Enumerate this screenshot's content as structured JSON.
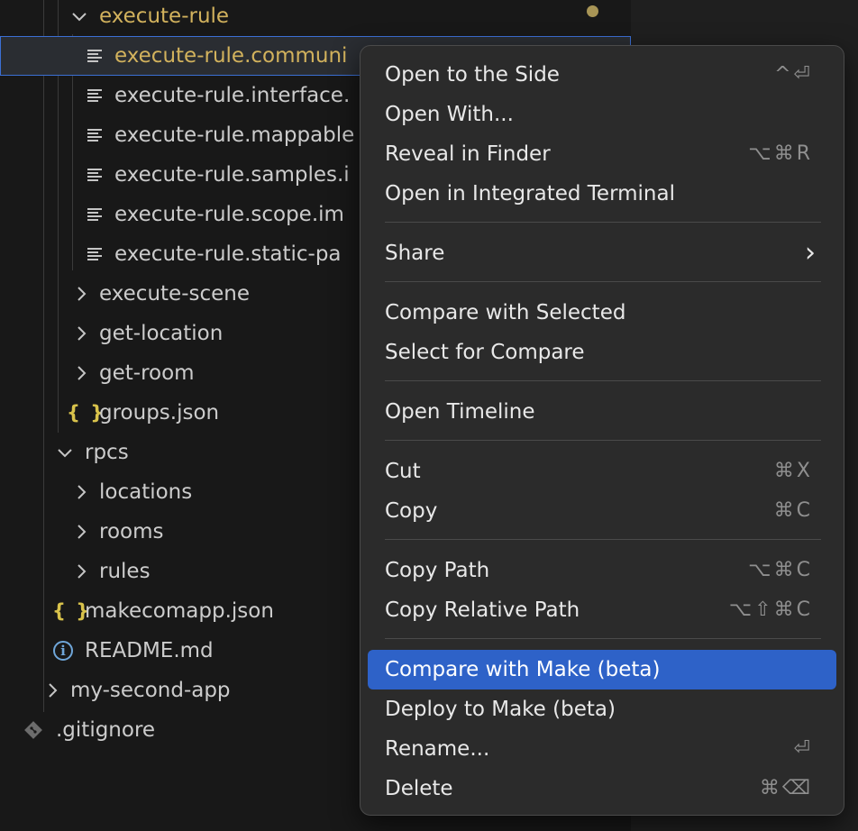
{
  "explorer": {
    "items": [
      {
        "label": "execute-rule",
        "icon": "chevron-down-icon",
        "modified": true
      },
      {
        "label": "execute-rule.communi",
        "icon": "file-lines-icon",
        "selected": true
      },
      {
        "label": "execute-rule.interface.",
        "icon": "file-lines-icon"
      },
      {
        "label": "execute-rule.mappable",
        "icon": "file-lines-icon"
      },
      {
        "label": "execute-rule.samples.i",
        "icon": "file-lines-icon"
      },
      {
        "label": "execute-rule.scope.im",
        "icon": "file-lines-icon"
      },
      {
        "label": "execute-rule.static-pa",
        "icon": "file-lines-icon"
      },
      {
        "label": "execute-scene",
        "icon": "chevron-right-icon"
      },
      {
        "label": "get-location",
        "icon": "chevron-right-icon"
      },
      {
        "label": "get-room",
        "icon": "chevron-right-icon"
      },
      {
        "label": "groups.json",
        "icon": "json-braces-icon"
      },
      {
        "label": "rpcs",
        "icon": "chevron-down-icon"
      },
      {
        "label": "locations",
        "icon": "chevron-right-icon"
      },
      {
        "label": "rooms",
        "icon": "chevron-right-icon"
      },
      {
        "label": "rules",
        "icon": "chevron-right-icon"
      },
      {
        "label": "makecomapp.json",
        "icon": "json-braces-icon"
      },
      {
        "label": "README.md",
        "icon": "info-icon"
      },
      {
        "label": "my-second-app",
        "icon": "chevron-right-icon"
      },
      {
        "label": ".gitignore",
        "icon": "git-icon"
      }
    ],
    "json_icon_glyph": "{ }",
    "info_icon_glyph": "i"
  },
  "context_menu": {
    "items": [
      {
        "label": "Open to the Side",
        "shortcut": "^⏎"
      },
      {
        "label": "Open With...",
        "shortcut": ""
      },
      {
        "label": "Reveal in Finder",
        "shortcut": "⌥⌘R"
      },
      {
        "label": "Open in Integrated Terminal",
        "shortcut": ""
      },
      {
        "label": "Share",
        "shortcut": "›"
      },
      {
        "label": "Compare with Selected",
        "shortcut": ""
      },
      {
        "label": "Select for Compare",
        "shortcut": ""
      },
      {
        "label": "Open Timeline",
        "shortcut": ""
      },
      {
        "label": "Cut",
        "shortcut": "⌘X"
      },
      {
        "label": "Copy",
        "shortcut": "⌘C"
      },
      {
        "label": "Copy Path",
        "shortcut": "⌥⌘C"
      },
      {
        "label": "Copy Relative Path",
        "shortcut": "⌥⇧⌘C"
      },
      {
        "label": "Compare with Make (beta)",
        "shortcut": "",
        "highlighted": true
      },
      {
        "label": "Deploy to Make (beta)",
        "shortcut": ""
      },
      {
        "label": "Rename...",
        "shortcut": "⏎"
      },
      {
        "label": "Delete",
        "shortcut": "⌘⌫"
      }
    ]
  },
  "colors": {
    "accent": "#2e62c8",
    "modified": "#d2b25d",
    "background": "#181818",
    "menu_background": "#2b2b2b"
  }
}
